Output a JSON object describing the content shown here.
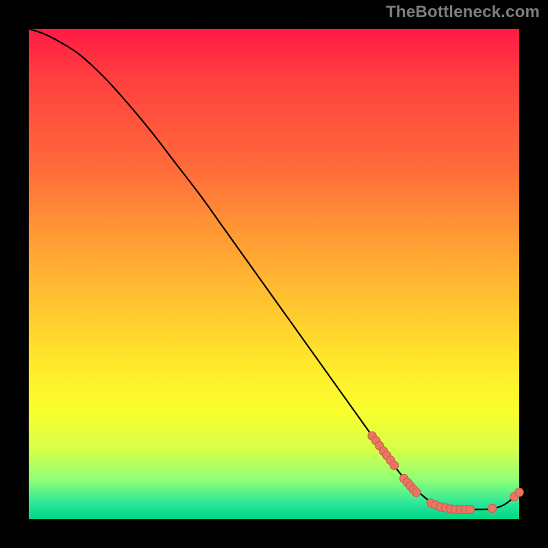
{
  "watermark": "TheBottleneck.com",
  "colors": {
    "frame_bg": "#000000",
    "curve_stroke": "#000000",
    "marker_fill": "#e97662",
    "marker_stroke": "#c95a48",
    "gradient_top": "#ff1a44",
    "gradient_bottom": "#00d784"
  },
  "chart_data": {
    "type": "line",
    "title": "",
    "xlabel": "",
    "ylabel": "",
    "xlim": [
      0,
      100
    ],
    "ylim": [
      0,
      100
    ],
    "grid": false,
    "series": [
      {
        "name": "curve",
        "x": [
          0,
          3,
          6,
          10,
          15,
          20,
          25,
          30,
          35,
          40,
          45,
          50,
          55,
          60,
          65,
          70,
          73,
          76,
          79,
          82,
          85,
          88,
          91,
          94,
          97,
          100
        ],
        "y": [
          100,
          99,
          97.5,
          95,
          90.5,
          85,
          79,
          72.5,
          66,
          59,
          52,
          45,
          38,
          31,
          24,
          17,
          13,
          9,
          6,
          3.5,
          2.3,
          2,
          2,
          2.1,
          3,
          5.5
        ]
      }
    ],
    "markers": [
      {
        "x": 70.0,
        "y": 17.0
      },
      {
        "x": 70.8,
        "y": 16.0
      },
      {
        "x": 71.5,
        "y": 15.0
      },
      {
        "x": 72.3,
        "y": 13.9
      },
      {
        "x": 73.0,
        "y": 13.0
      },
      {
        "x": 73.8,
        "y": 12.0
      },
      {
        "x": 74.5,
        "y": 11.0
      },
      {
        "x": 76.5,
        "y": 8.3
      },
      {
        "x": 77.2,
        "y": 7.5
      },
      {
        "x": 77.8,
        "y": 6.8
      },
      {
        "x": 78.4,
        "y": 6.1
      },
      {
        "x": 79.0,
        "y": 5.5
      },
      {
        "x": 82.0,
        "y": 3.3
      },
      {
        "x": 83.0,
        "y": 2.9
      },
      {
        "x": 84.0,
        "y": 2.5
      },
      {
        "x": 85.0,
        "y": 2.3
      },
      {
        "x": 86.0,
        "y": 2.1
      },
      {
        "x": 87.0,
        "y": 2.0
      },
      {
        "x": 88.0,
        "y": 2.0
      },
      {
        "x": 89.0,
        "y": 2.0
      },
      {
        "x": 90.0,
        "y": 2.0
      },
      {
        "x": 94.5,
        "y": 2.2
      },
      {
        "x": 99.0,
        "y": 4.6
      },
      {
        "x": 100.0,
        "y": 5.5
      }
    ]
  }
}
